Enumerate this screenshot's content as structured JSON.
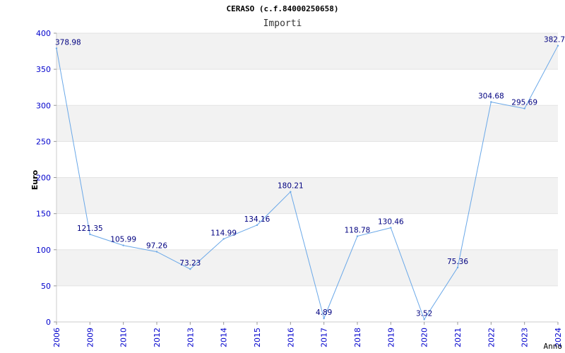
{
  "chart_data": {
    "type": "line",
    "title": "CERASO (c.f.84000250658)",
    "subtitle": "Importi",
    "xlabel": "Anno",
    "ylabel": "Euro",
    "categories": [
      "2006",
      "2009",
      "2010",
      "2012",
      "2013",
      "2014",
      "2015",
      "2016",
      "2017",
      "2018",
      "2019",
      "2020",
      "2021",
      "2022",
      "2023",
      "2024"
    ],
    "series": [
      {
        "values": [
          378.98,
          121.35,
          105.99,
          97.26,
          73.23,
          114.99,
          134.16,
          180.21,
          4.89,
          118.78,
          130.46,
          3.52,
          75.36,
          304.68,
          295.69,
          382.7
        ]
      }
    ],
    "data_labels": [
      "378.98",
      "121.35",
      "105.99",
      "97.26",
      "73.23",
      "114.99",
      "134.16",
      "180.21",
      "4.89",
      "118.78",
      "130.46",
      "3.52",
      "75.36",
      "304.68",
      "295.69",
      "382.7"
    ],
    "ylim": [
      0,
      400
    ],
    "yticks": [
      "0",
      "50",
      "100",
      "150",
      "200",
      "250",
      "300",
      "350",
      "400"
    ],
    "grid": true,
    "colors": {
      "line": "#6aa8e8",
      "band": "#f2f2f2",
      "tick_text": "#0000cc",
      "label_text": "#000080"
    }
  }
}
